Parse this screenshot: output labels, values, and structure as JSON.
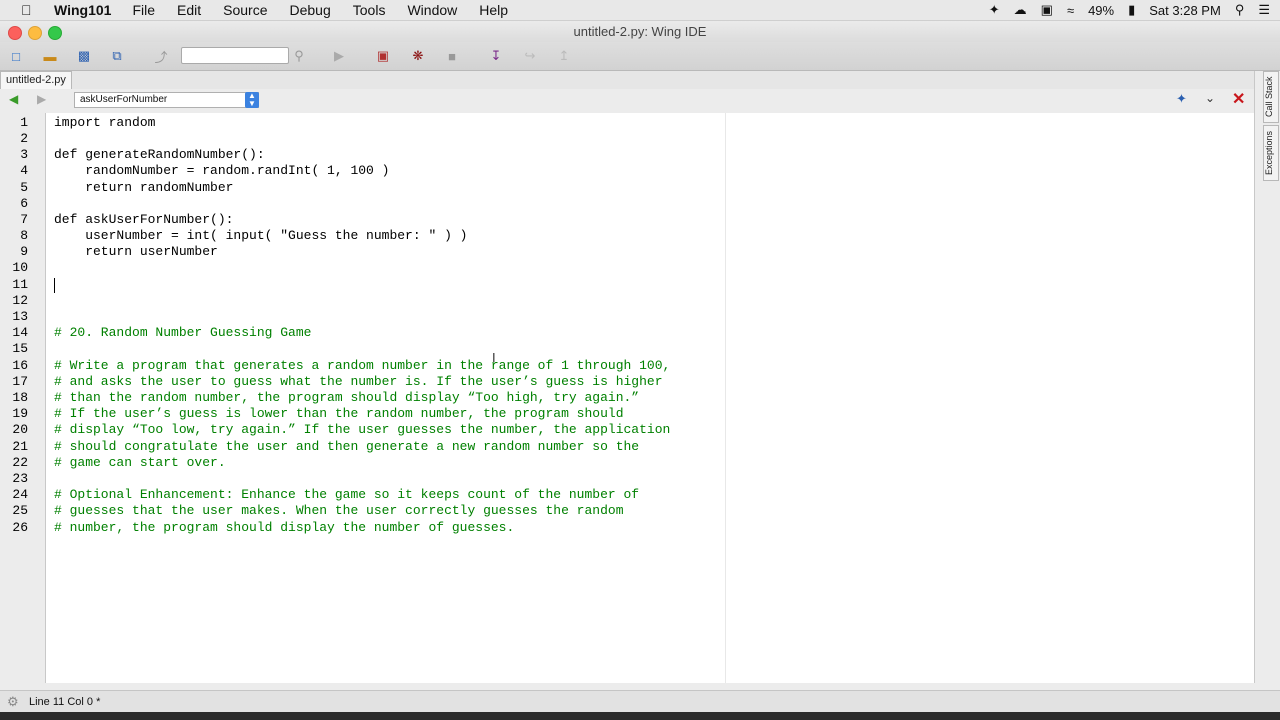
{
  "menubar": {
    "app": "Wing101",
    "menus": [
      "File",
      "Edit",
      "Source",
      "Debug",
      "Tools",
      "Window",
      "Help"
    ],
    "battery": "49%",
    "clock": "Sat 3:28 PM"
  },
  "window": {
    "title": "untitled-2.py: Wing IDE"
  },
  "tab": {
    "label": "untitled-2.py"
  },
  "navbar": {
    "function_selector": "askUserForNumber"
  },
  "editor": {
    "line_numbers": [
      "1",
      "2",
      "3",
      "4",
      "5",
      "6",
      "7",
      "8",
      "9",
      "10",
      "11",
      "12",
      "13",
      "14",
      "15",
      "16",
      "17",
      "18",
      "19",
      "20",
      "21",
      "22",
      "23",
      "24",
      "25",
      "26"
    ],
    "lines": [
      "import random",
      "",
      "def generateRandomNumber():",
      "    randomNumber = random.randInt( 1, 100 )",
      "    return randomNumber",
      "",
      "def askUserForNumber():",
      "    userNumber = int( input( \"Guess the number: \" ) )",
      "    return userNumber",
      "",
      "",
      "",
      "",
      "# 20. Random Number Guessing Game",
      "",
      "# Write a program that generates a random number in the range of 1 through 100,",
      "# and asks the user to guess what the number is. If the user’s guess is higher",
      "# than the random number, the program should display “Too high, try again.”",
      "# If the user’s guess is lower than the random number, the program should",
      "# display “Too low, try again.” If the user guesses the number, the application",
      "# should congratulate the user and then generate a new random number so the",
      "# game can start over.",
      "",
      "# Optional Enhancement: Enhance the game so it keeps count of the number of",
      "# guesses that the user makes. When the user correctly guesses the random",
      "# number, the program should display the number of guesses."
    ]
  },
  "sidebar": {
    "tabs": [
      "Call Stack",
      "Exceptions"
    ]
  },
  "status": {
    "text": "Line 11 Col 0 *"
  }
}
